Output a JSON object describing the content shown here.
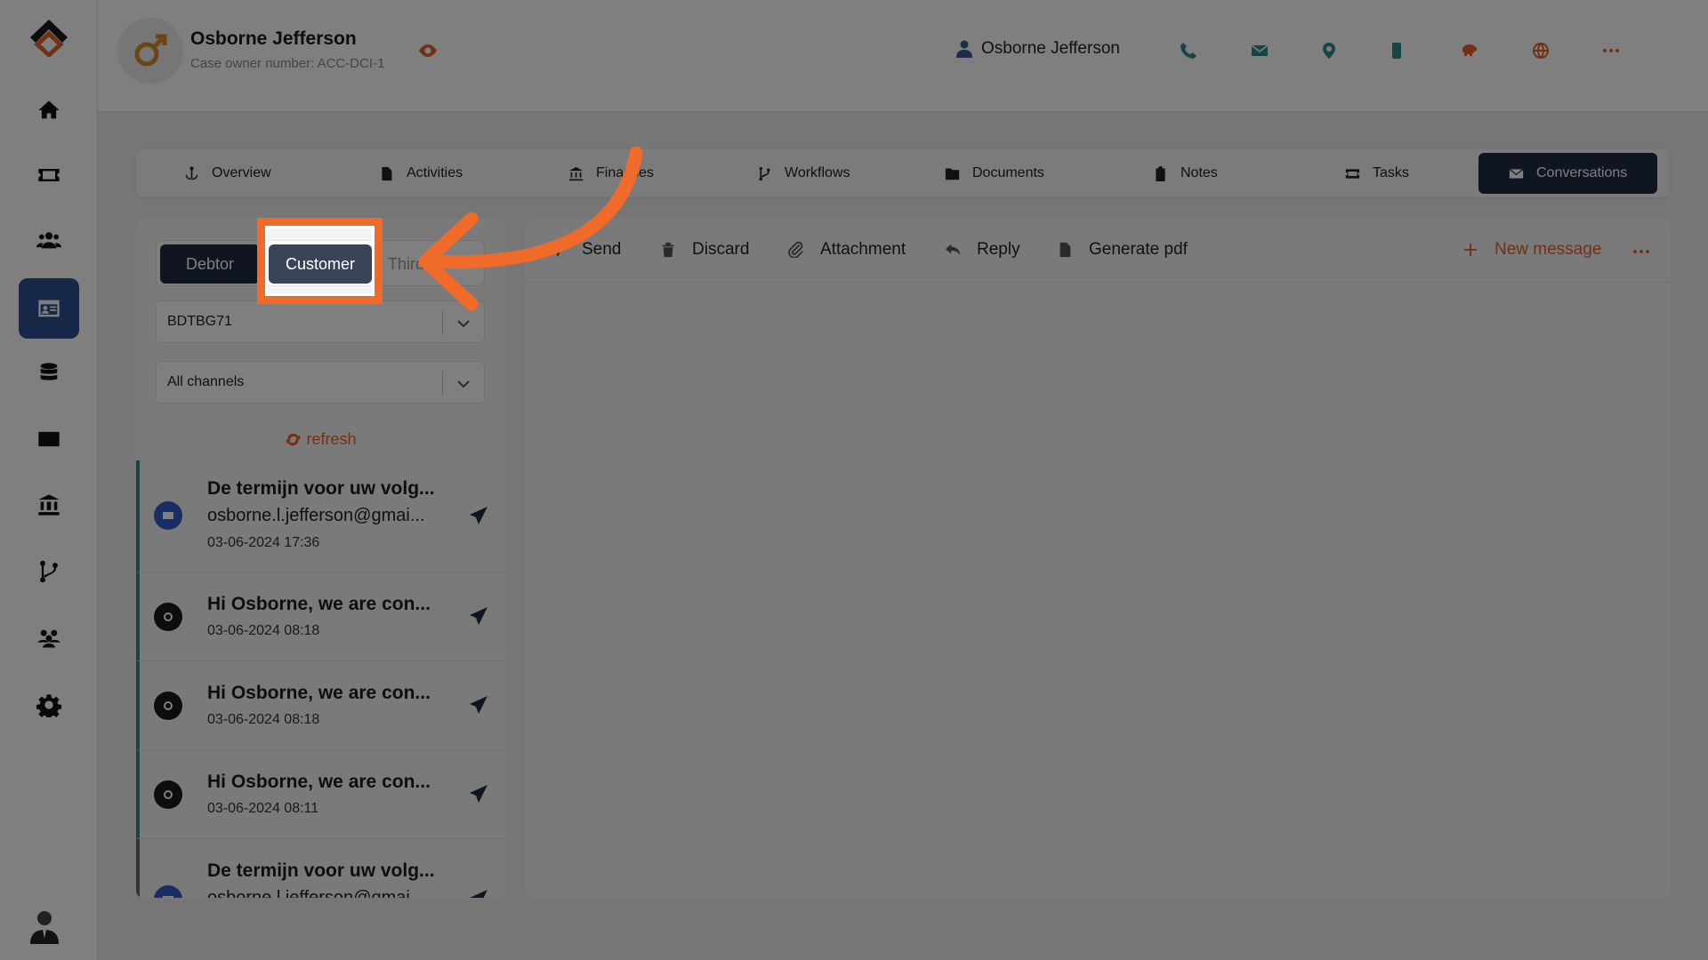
{
  "header": {
    "owner_name": "Osborne Jefferson",
    "case_owner": "Case owner number: ACC-DCI-1",
    "user_name": "Osborne Jefferson",
    "icons": [
      "phone-icon",
      "mail-icon",
      "location-icon",
      "mobile-icon",
      "piggy-bank-icon",
      "globe-icon",
      "more-icon",
      "chevron-down-icon"
    ]
  },
  "sidebar": {
    "items": [
      "home",
      "ticket",
      "users",
      "contact-card",
      "database",
      "mail",
      "bank",
      "workflow",
      "team",
      "settings"
    ],
    "active": "contact-card"
  },
  "tabs": [
    {
      "label": "Overview",
      "icon": "anchor-icon"
    },
    {
      "label": "Activities",
      "icon": "file-icon"
    },
    {
      "label": "Finances",
      "icon": "bank-icon"
    },
    {
      "label": "Workflows",
      "icon": "branch-icon"
    },
    {
      "label": "Documents",
      "icon": "folder-icon"
    },
    {
      "label": "Notes",
      "icon": "clipboard-icon"
    },
    {
      "label": "Tasks",
      "icon": "ticket-icon"
    },
    {
      "label": "Conversations",
      "icon": "mail-icon",
      "active": true
    }
  ],
  "segment": {
    "debtor": "Debtor",
    "customer": "Customer",
    "third": "Third"
  },
  "filters": {
    "account": "BDTBG71",
    "channel": "All channels"
  },
  "refresh_label": "refresh",
  "messages": [
    {
      "title": "De termijn voor uw volg...",
      "sub": "osborne.l.jefferson@gmai...",
      "time": "03-06-2024 17:36",
      "channel": "mail"
    },
    {
      "title": "Hi Osborne, we are con...",
      "sub": "",
      "time": "03-06-2024 08:18",
      "channel": "whatsapp"
    },
    {
      "title": "Hi Osborne, we are con...",
      "sub": "",
      "time": "03-06-2024 08:18",
      "channel": "whatsapp"
    },
    {
      "title": "Hi Osborne, we are con...",
      "sub": "",
      "time": "03-06-2024 08:11",
      "channel": "whatsapp"
    },
    {
      "title": "De termijn voor uw volg...",
      "sub": "osborne.l.jefferson@gmai...",
      "time": "",
      "channel": "mail"
    }
  ],
  "toolbar": {
    "send": "Send",
    "discard": "Discard",
    "attachment": "Attachment",
    "reply": "Reply",
    "generate_pdf": "Generate pdf",
    "new_message": "New message"
  },
  "colors": {
    "accent": "#e2622a",
    "nav_dark": "#1f2d44",
    "active_blue": "#2f4e8e",
    "highlight": "#f06a2a"
  }
}
